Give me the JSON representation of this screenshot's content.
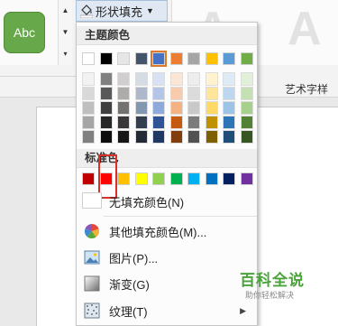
{
  "ribbon": {
    "style_preview_label": "Abc",
    "shape_fill_label": "形状填充",
    "wordart_letters": [
      "A",
      "A"
    ],
    "wordart_group_label": "艺术字样"
  },
  "dropdown": {
    "theme_colors_header": "主题颜色",
    "standard_colors_header": "标准色",
    "theme_top_row": [
      "#ffffff",
      "#000000",
      "#e7e6e6",
      "#44546a",
      "#4472c4",
      "#ed7d31",
      "#a5a5a5",
      "#ffc000",
      "#5b9bd5",
      "#70ad47"
    ],
    "theme_shades": [
      [
        "#f2f2f2",
        "#d9d9d9",
        "#bfbfbf",
        "#a6a6a6",
        "#808080"
      ],
      [
        "#808080",
        "#595959",
        "#404040",
        "#262626",
        "#0d0d0d"
      ],
      [
        "#d0cece",
        "#aeabab",
        "#757171",
        "#3a3838",
        "#171616"
      ],
      [
        "#d6dce4",
        "#adb9ca",
        "#8497b0",
        "#333f4f",
        "#222a35"
      ],
      [
        "#d9e2f3",
        "#b4c6e7",
        "#8eaadb",
        "#2f5496",
        "#1f3864"
      ],
      [
        "#fbe5d5",
        "#f7cbac",
        "#f4b183",
        "#c55a11",
        "#833c0b"
      ],
      [
        "#ededed",
        "#dbdbdb",
        "#c9c9c9",
        "#7b7b7b",
        "#525252"
      ],
      [
        "#fff2cc",
        "#fee599",
        "#ffd965",
        "#bf9000",
        "#7f6000"
      ],
      [
        "#deebf6",
        "#bdd7ee",
        "#9dc3e6",
        "#2e75b5",
        "#1e4e79"
      ],
      [
        "#e2efd9",
        "#c5e0b3",
        "#a8d08d",
        "#538135",
        "#375623"
      ]
    ],
    "selected_theme_index": 4,
    "standard_colors": [
      "#c00000",
      "#ff0000",
      "#ffc000",
      "#ffff00",
      "#92d050",
      "#00b050",
      "#00b0f0",
      "#0070c0",
      "#002060",
      "#7030a0"
    ],
    "no_fill_label": "无填充颜色(N)",
    "more_colors_label": "其他填充颜色(M)...",
    "picture_label": "图片(P)...",
    "gradient_label": "渐变(G)",
    "texture_label": "纹理(T)"
  },
  "watermark": {
    "main": "百科全说",
    "sub": "助你轻松解决"
  }
}
